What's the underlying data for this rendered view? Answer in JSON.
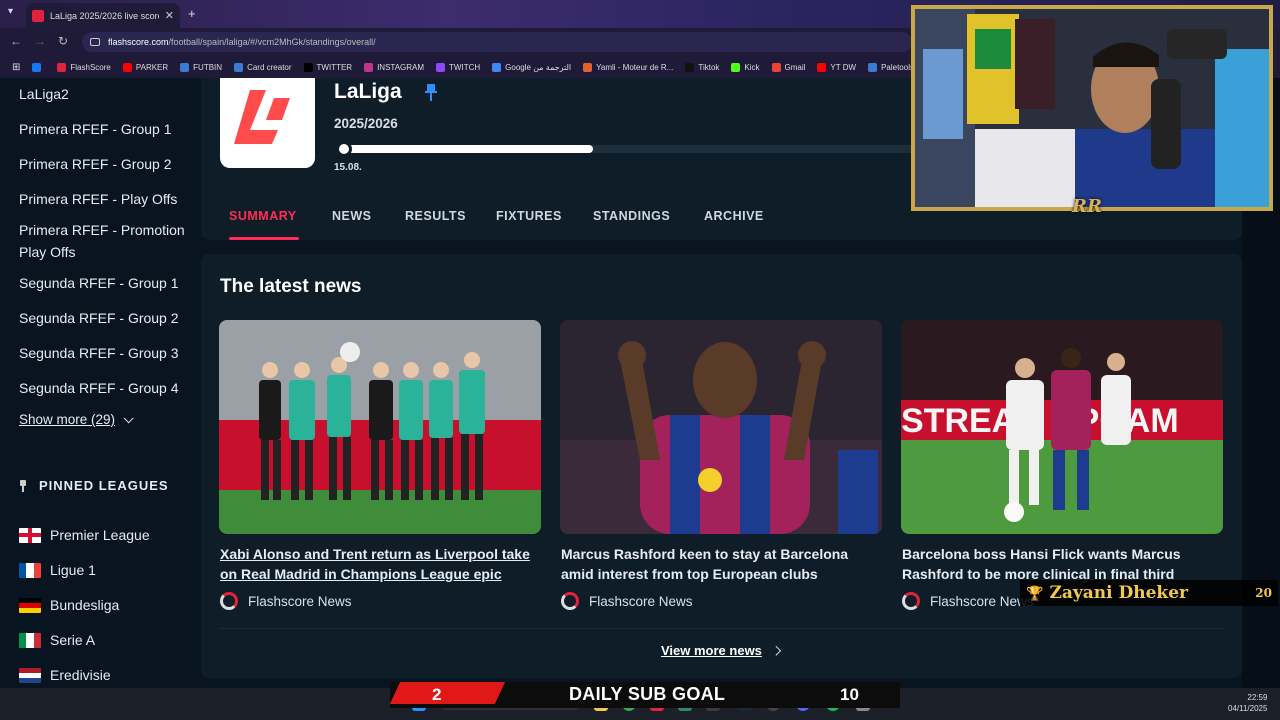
{
  "browser": {
    "tab_title": "LaLiga 2025/2026 live scores",
    "url_host": "flashscore.com",
    "url_path": "/football/spain/laliga/#/vcm2MhGk/standings/overall/",
    "bookmarks": [
      {
        "label": "",
        "color": "#1877f2"
      },
      {
        "label": "FlashScore",
        "color": "#e0243c"
      },
      {
        "label": "PARKER",
        "color": "#ff0000"
      },
      {
        "label": "FUTBIN",
        "color": "#3a7bd5"
      },
      {
        "label": "Card creator",
        "color": "#3a7bd5"
      },
      {
        "label": "TWITTER",
        "color": "#000000"
      },
      {
        "label": "INSTAGRAM",
        "color": "#c13584"
      },
      {
        "label": "TWITCH",
        "color": "#9146ff"
      },
      {
        "label": "Google الترجمة من",
        "color": "#4285f4"
      },
      {
        "label": "Yamli - Moteur de R...",
        "color": "#e06030"
      },
      {
        "label": "Tiktok",
        "color": "#111111"
      },
      {
        "label": "Kick",
        "color": "#53fc18"
      },
      {
        "label": "Gmail",
        "color": "#ea4335"
      },
      {
        "label": "YT DW",
        "color": "#ff0000"
      },
      {
        "label": "Paletools v2",
        "color": "#3a7bd5"
      }
    ]
  },
  "sidebar": {
    "leagues": [
      "LaLiga2",
      "Primera RFEF - Group 1",
      "Primera RFEF - Group 2",
      "Primera RFEF - Play Offs",
      "Primera RFEF - Promotion Play Offs",
      "Segunda RFEF - Group 1",
      "Segunda RFEF - Group 2",
      "Segunda RFEF - Group 3",
      "Segunda RFEF - Group 4"
    ],
    "show_more": "Show more (29)",
    "pinned_heading": "PINNED LEAGUES",
    "pinned": [
      {
        "label": "Premier League",
        "flag": "england-flag"
      },
      {
        "label": "Ligue 1",
        "flag": "france-flag"
      },
      {
        "label": "Bundesliga",
        "flag": "germany-flag"
      },
      {
        "label": "Serie A",
        "flag": "italy-flag"
      },
      {
        "label": "Eredivisie",
        "flag": "netherlands-flag"
      }
    ]
  },
  "league": {
    "name": "LaLiga",
    "season": "2025/2026",
    "start_date": "15.08.",
    "season_progress": 0.44,
    "tabs": [
      "SUMMARY",
      "NEWS",
      "RESULTS",
      "FIXTURES",
      "STANDINGS",
      "ARCHIVE"
    ],
    "active_tab": "SUMMARY"
  },
  "news": {
    "title": "The latest news",
    "items": [
      {
        "headline_l1": "Xabi Alonso and Trent return as Liverpool take",
        "headline_l2": "on Real Madrid in Champions League epic",
        "source": "Flashscore News"
      },
      {
        "headline_l1": "Marcus Rashford keen to stay at Barcelona",
        "headline_l2": "amid interest from top European clubs",
        "source": "Flashscore News"
      },
      {
        "headline_l1": "Barcelona boss Hansi Flick wants Marcus",
        "headline_l2": "Rashford to be more clinical in final third",
        "source": "Flashscore News"
      }
    ],
    "view_more": "View more news"
  },
  "overlay": {
    "cam_logo": "RR",
    "donor_name": "Zayani Dheker",
    "donor_value": "20",
    "sub_goal_current": "2",
    "sub_goal_label": "DAILY SUB GOAL",
    "sub_goal_target": "10"
  },
  "taskbar": {
    "time": "22:59",
    "date": "04/11/2025"
  },
  "colors": {
    "accent": "#ff2d55",
    "brand_red": "#e0243c",
    "frame_gold": "#c9a84a"
  }
}
